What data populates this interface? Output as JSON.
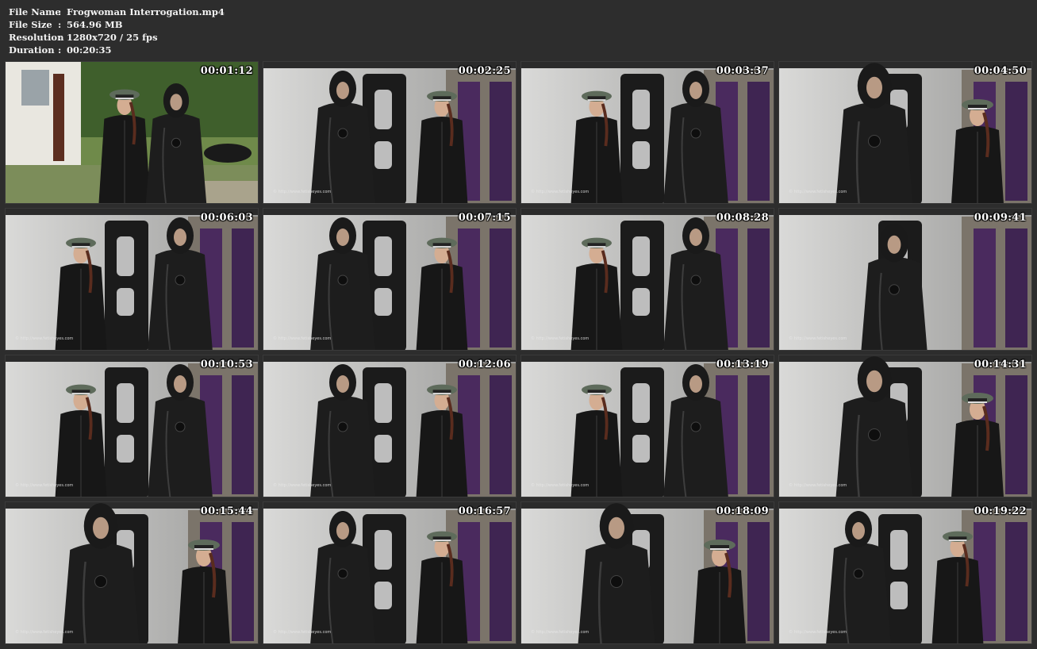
{
  "file_info": [
    {
      "label": "File Name",
      "sep": ":",
      "value": "Frogwoman Interrogation.mp4"
    },
    {
      "label": "File Size",
      "sep": ":",
      "value": "564.96 MB"
    },
    {
      "label": "Resolution",
      "sep": ":",
      "value": "1280x720 / 25 fps"
    },
    {
      "label": "Duration",
      "sep": ":",
      "value": "00:20:35"
    }
  ],
  "watermark_text": "© http://www.fetisheyes.com",
  "colors": {
    "background": "#2d2d2d",
    "text": "#f2f2f2",
    "suit": "#1c1c1c",
    "cap": "#5d6b5a",
    "wall": "#c9c9c7",
    "purple_panel": "#4a2a5e"
  },
  "thumbnails": [
    {
      "time": "00:01:12",
      "scene": "garden"
    },
    {
      "time": "00:02:25",
      "scene": "room"
    },
    {
      "time": "00:03:37",
      "scene": "room"
    },
    {
      "time": "00:04:50",
      "scene": "room-close"
    },
    {
      "time": "00:06:03",
      "scene": "room"
    },
    {
      "time": "00:07:15",
      "scene": "room"
    },
    {
      "time": "00:08:28",
      "scene": "room"
    },
    {
      "time": "00:09:41",
      "scene": "room-single"
    },
    {
      "time": "00:10:53",
      "scene": "room"
    },
    {
      "time": "00:12:06",
      "scene": "room"
    },
    {
      "time": "00:13:19",
      "scene": "room"
    },
    {
      "time": "00:14:31",
      "scene": "room-close"
    },
    {
      "time": "00:15:44",
      "scene": "room-close"
    },
    {
      "time": "00:16:57",
      "scene": "room"
    },
    {
      "time": "00:18:09",
      "scene": "room-close"
    },
    {
      "time": "00:19:22",
      "scene": "room"
    }
  ]
}
